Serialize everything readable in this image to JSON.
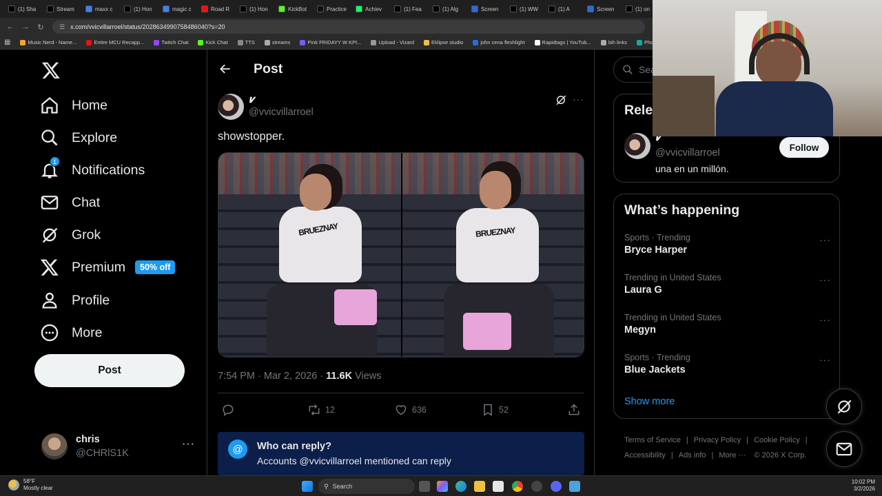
{
  "browser": {
    "tabs": [
      "(1) Sha",
      "Stream",
      "maxx c",
      "(1) Hon",
      "magic c",
      "Road R",
      "(1) Hon",
      "KickBot",
      "Practice",
      "Achiev",
      "(1) Fea",
      "(1) Alg",
      "Screen",
      "(1) WW",
      "(1) A",
      "Screen",
      "(1) on"
    ],
    "url": "x.com/vvicvillarroel/status/2028634990758486040?s=20",
    "bookmarks": [
      "Music Nerd - Name...",
      "Entire MCU Recapp...",
      "Twitch Chat",
      "Kick Chat",
      "TTS",
      "streams",
      "Pink FRIDAYY W KPI...",
      "Upload - Vizard",
      "Eklipse studio",
      "john cena fleshlight",
      "Rapidtags | YouTub...",
      "bih links",
      "Photop"
    ]
  },
  "nav": {
    "home": "Home",
    "explore": "Explore",
    "notifications": "Notifications",
    "notif_count": "1",
    "chat": "Chat",
    "grok": "Grok",
    "premium": "Premium",
    "premium_badge": "50% off",
    "profile": "Profile",
    "more": "More",
    "post_button": "Post",
    "user_name": "chris",
    "user_handle": "@CHRlS1K"
  },
  "main": {
    "header": "Post",
    "author_name": "𝒗",
    "author_handle": "@vvicvillarroel",
    "text": "showstopper.",
    "timestamp": "7:54 PM · Mar 2, 2026 · ",
    "views_count": "11.6K",
    "views_label": " Views",
    "reposts": "12",
    "likes": "636",
    "bookmarks": "52",
    "reply_title": "Who can reply?",
    "reply_text": "Accounts @vvicvillarroel mentioned can reply",
    "shirt_text": "BRUEZNAY"
  },
  "right": {
    "search_placeholder": "Sear",
    "relevant_title": "Rele",
    "relevant_name": "𝒗",
    "relevant_handle": "@vvicvillarroel",
    "relevant_bio": "una en un millón.",
    "follow": "Follow",
    "happening_title": "What’s happening",
    "trends": [
      {
        "category": "Sports · Trending",
        "name": "Bryce Harper"
      },
      {
        "category": "Trending in United States",
        "name": "Laura G"
      },
      {
        "category": "Trending in United States",
        "name": "Megyn"
      },
      {
        "category": "Sports · Trending",
        "name": "Blue Jackets"
      }
    ],
    "show_more": "Show more",
    "footer": [
      "Terms of Service",
      "Privacy Policy",
      "Cookie Policy",
      "Accessibility",
      "Ads info",
      "More ···",
      "© 2026 X Corp."
    ]
  },
  "taskbar": {
    "weather_temp": "58°F",
    "weather_desc": "Mostly clear",
    "search": "Search",
    "time": "10:02 PM",
    "date": "3/2/2026"
  },
  "colors": {
    "accent": "#1d9bf0",
    "premium_badge": "#1d9bf0",
    "reply_box": "#0c1f4a"
  }
}
